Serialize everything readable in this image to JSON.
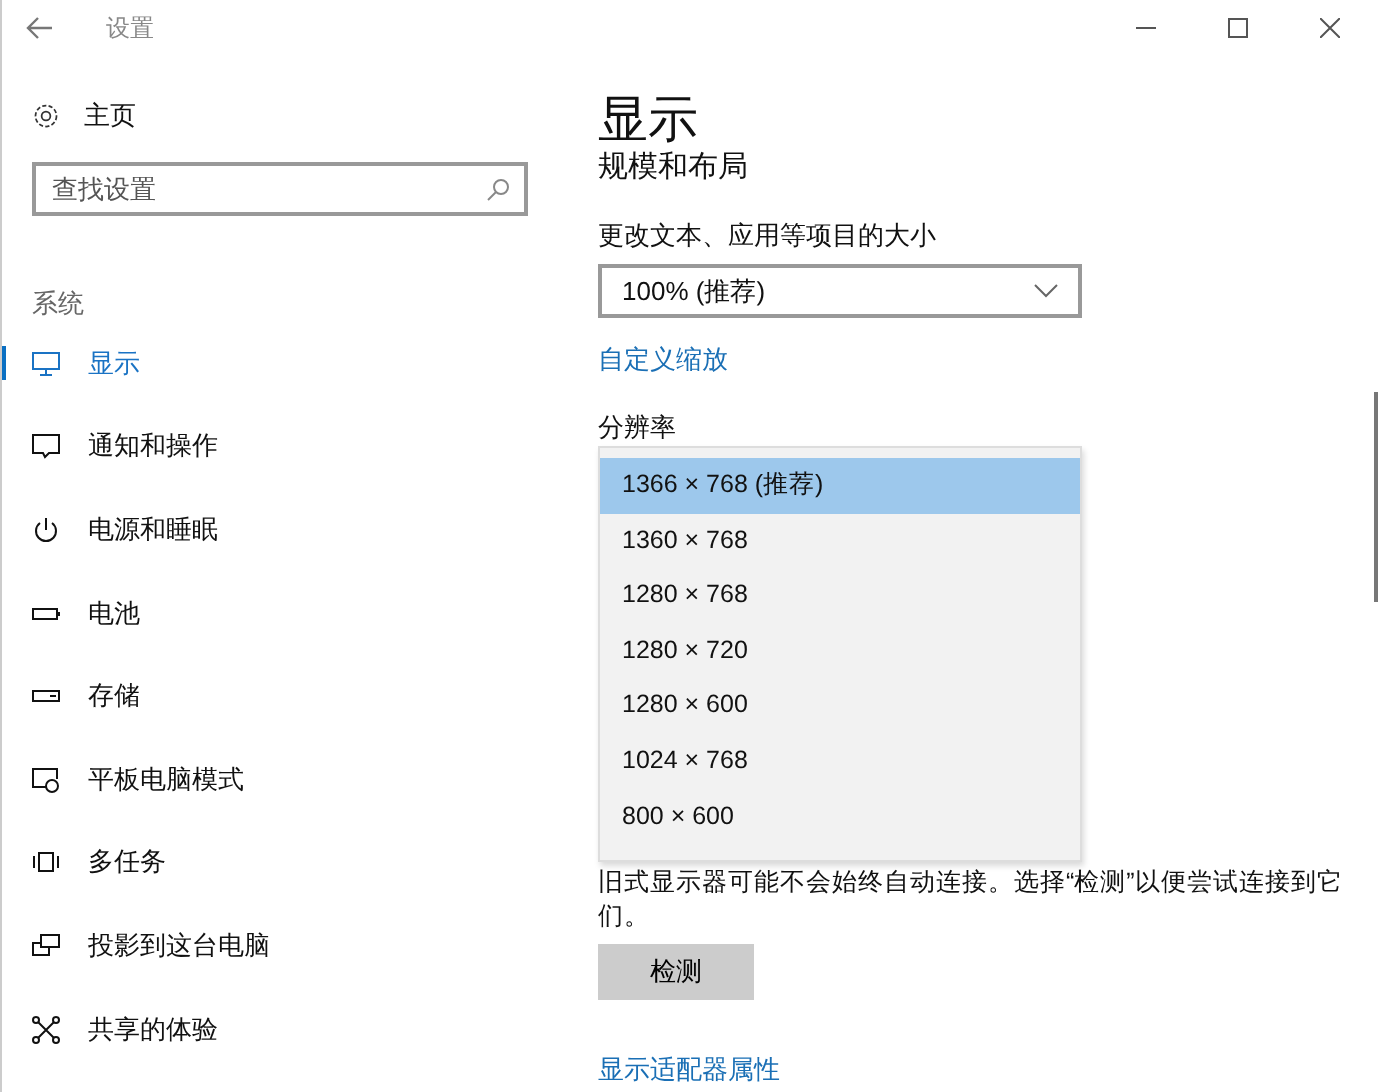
{
  "window": {
    "title": "设置"
  },
  "sidebar": {
    "home": "主页",
    "search": {
      "placeholder": "查找设置"
    },
    "section": "系统",
    "items": [
      {
        "label": "显示",
        "selected": true
      },
      {
        "label": "通知和操作",
        "selected": false
      },
      {
        "label": "电源和睡眠",
        "selected": false
      },
      {
        "label": "电池",
        "selected": false
      },
      {
        "label": "存储",
        "selected": false
      },
      {
        "label": "平板电脑模式",
        "selected": false
      },
      {
        "label": "多任务",
        "selected": false
      },
      {
        "label": "投影到这台电脑",
        "selected": false
      },
      {
        "label": "共享的体验",
        "selected": false
      }
    ]
  },
  "content": {
    "title": "显示",
    "subtitle": "规模和布局",
    "scale_label": "更改文本、应用等项目的大小",
    "scale_value": "100% (推荐)",
    "custom_scaling_link": "自定义缩放",
    "resolution_label": "分辨率",
    "resolution_options": [
      {
        "label": "1366 × 768 (推荐)",
        "selected": true
      },
      {
        "label": "1360 × 768",
        "selected": false
      },
      {
        "label": "1280 × 768",
        "selected": false
      },
      {
        "label": "1280 × 720",
        "selected": false
      },
      {
        "label": "1280 × 600",
        "selected": false
      },
      {
        "label": "1024 × 768",
        "selected": false
      },
      {
        "label": "800 × 600",
        "selected": false
      }
    ],
    "detect_note": "旧式显示器可能不会始终自动连接。选择“检测”以便尝试连接到它们。",
    "detect_button": "检测",
    "adapter_link": "显示适配器属性"
  }
}
